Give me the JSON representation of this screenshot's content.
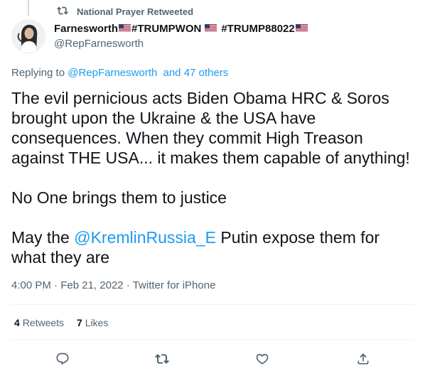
{
  "social_context": {
    "label": "National Prayer Retweeted",
    "icon": "retweet-icon"
  },
  "author": {
    "name_parts": [
      "Farnesworth",
      "#TRUMPWON",
      "#TRUMP88022"
    ],
    "handle": "@RepFarnesworth",
    "avatar": "profile-photo"
  },
  "replying": {
    "prefix": "Replying to",
    "mention": "@RepFarnesworth",
    "others": "and 47 others"
  },
  "tweet": {
    "para1": "The evil pernicious acts Biden Obama HRC  & Soros brought upon the Ukraine & the USA have consequences. When they commit High Treason against THE USA... it makes them capable of anything!",
    "para2": "No One brings them to justice",
    "para3_prefix": "May the",
    "para3_mention": "@KremlinRussia_E",
    "para3_suffix": "Putin expose them for what they are"
  },
  "meta": {
    "time": "4:00 PM",
    "sep": "·",
    "date": "Feb 21, 2022",
    "source": "Twitter for iPhone"
  },
  "stats": {
    "retweets_count": "4",
    "retweets_label": "Retweets",
    "likes_count": "7",
    "likes_label": "Likes"
  },
  "actions": [
    "reply-icon",
    "retweet-icon",
    "like-icon",
    "share-icon"
  ],
  "colors": {
    "link": "#1d9bf0",
    "muted": "#536471",
    "text": "#0f1419",
    "divider": "#eff3f4"
  }
}
